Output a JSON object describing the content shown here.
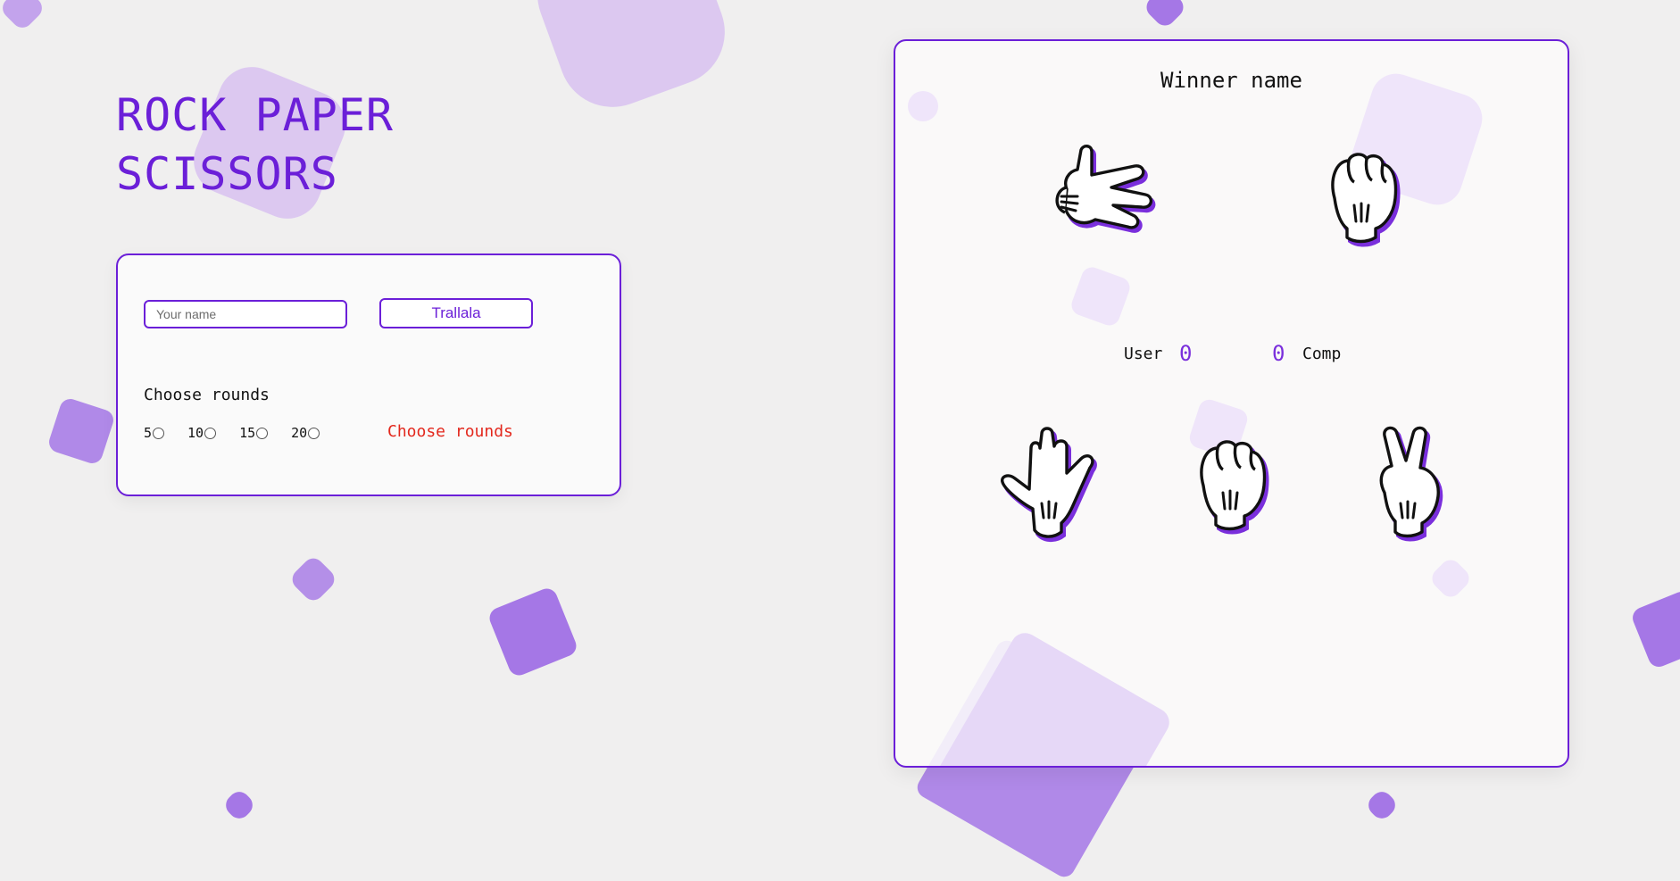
{
  "title": {
    "line1": "ROCK PAPER",
    "line2": "SCISSORS"
  },
  "setup": {
    "name_placeholder": "Your name",
    "name_button": "Trallala",
    "rounds_label": "Choose rounds",
    "round_options": [
      "5",
      "10",
      "15",
      "20"
    ],
    "rounds_warning": "Choose rounds"
  },
  "game": {
    "winner_name": "Winner name",
    "user_label": "User",
    "user_score": "0",
    "comp_score": "0",
    "comp_label": "Comp",
    "user_choice_icon": "scissors-hand-icon",
    "comp_choice_icon": "rock-hand-icon",
    "options": [
      {
        "name": "paper",
        "icon": "paper-hand-icon"
      },
      {
        "name": "rock",
        "icon": "rock-hand-icon"
      },
      {
        "name": "scissors",
        "icon": "scissors-hand-icon"
      }
    ]
  },
  "colors": {
    "accent": "#6b1fd8",
    "warning": "#e3281d",
    "background": "#f0efef",
    "panel": "#fafafa"
  }
}
